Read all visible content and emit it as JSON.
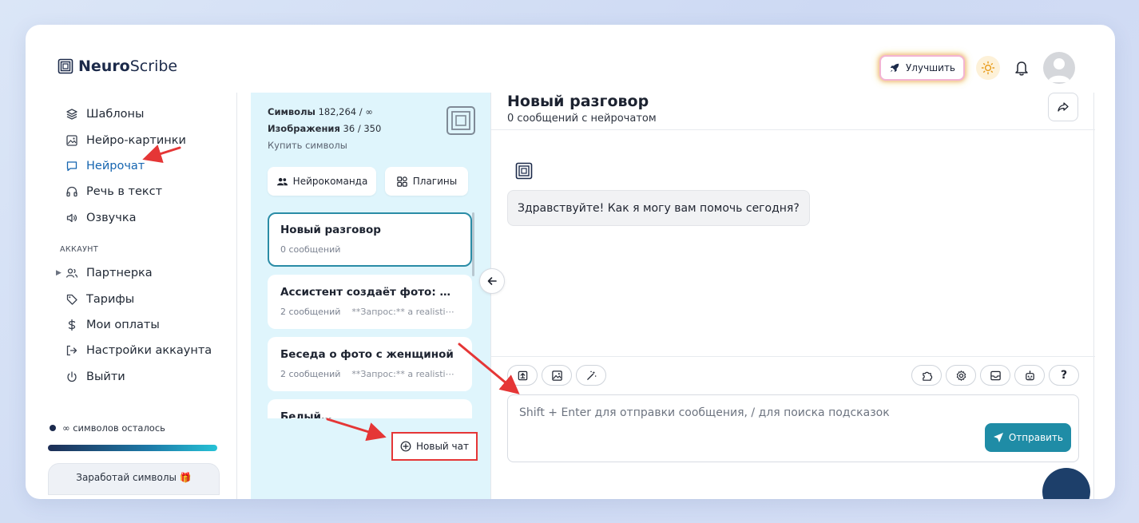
{
  "brand": {
    "bold": "Neuro",
    "normal": "Scribe"
  },
  "header": {
    "upgrade_label": "Улучшить"
  },
  "nav": {
    "items": [
      {
        "label": "Шаблоны",
        "icon": "layers-icon"
      },
      {
        "label": "Нейро-картинки",
        "icon": "image-icon"
      },
      {
        "label": "Нейрочат",
        "icon": "chat-icon",
        "active": true
      },
      {
        "label": "Речь в текст",
        "icon": "headphones-icon"
      },
      {
        "label": "Озвучка",
        "icon": "speaker-icon"
      }
    ],
    "section_label": "АККАУНТ",
    "account_items": [
      {
        "label": "Партнерка",
        "icon": "users-icon"
      },
      {
        "label": "Тарифы",
        "icon": "tag-icon"
      },
      {
        "label": "Мои оплаты",
        "icon": "dollar-icon"
      },
      {
        "label": "Настройки аккаунта",
        "icon": "login-icon"
      },
      {
        "label": "Выйти",
        "icon": "power-icon"
      }
    ],
    "symbols_left": "∞ символов осталось",
    "earn_label": "Заработай символы 🎁"
  },
  "panel": {
    "symbols_label": "Символы",
    "symbols_value": "182,264 / ∞",
    "images_label": "Изображения",
    "images_value": "36 / 350",
    "buy_label": "Купить символы",
    "team_label": "Нейрокоманда",
    "plugins_label": "Плагины",
    "chats": [
      {
        "title": "Новый разговор",
        "count": "0 сообщений",
        "preview": ""
      },
      {
        "title": "Ассистент создаёт фото: ж⋯",
        "count": "2 сообщений",
        "preview": "**Запрос:** a realisti⋯"
      },
      {
        "title": "Беседа о фото с женщиной",
        "count": "2 сообщений",
        "preview": "**Запрос:** a realisti⋯"
      },
      {
        "title": "Белый…",
        "count": "",
        "preview": ""
      }
    ],
    "new_chat_label": "Новый чат"
  },
  "chat": {
    "title": "Новый разговор",
    "subtitle": "0 сообщений с нейрочатом",
    "greeting": "Здравствуйте! Как я могу вам помочь сегодня?",
    "input_placeholder": "Shift + Enter для отправки сообщения, / для поиска подсказок",
    "send_label": "Отправить",
    "help_label": "?"
  },
  "colors": {
    "accent": "#1f8ca6",
    "panel_bg": "#dff5fc",
    "annotation": "#e53636"
  }
}
